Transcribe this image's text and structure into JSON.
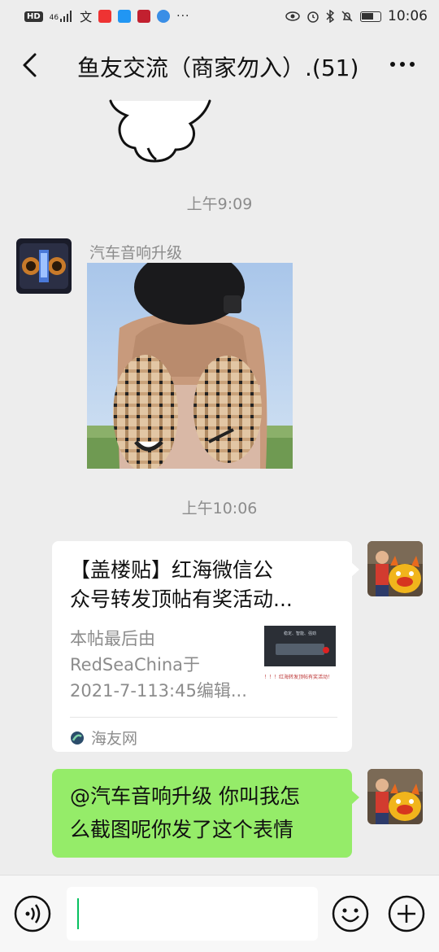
{
  "status_bar": {
    "left_icons": [
      "hd-icon",
      "signal-icon",
      "input-method-icon",
      "app-red-icon",
      "app-blue-icon",
      "app-target-icon",
      "app-globe-icon",
      "more-dots-icon"
    ],
    "hd_label": "HD",
    "network_label": "46",
    "right_icons": [
      "eye-icon",
      "alarm-icon",
      "bluetooth-icon",
      "mute-icon",
      "battery-icon"
    ],
    "time": "10:06"
  },
  "header": {
    "title": "鱼友交流（商家勿入）.(51)"
  },
  "chat": {
    "messages": [
      {
        "type": "timestamp",
        "text": "上午9:09"
      },
      {
        "type": "image",
        "sender": "汽车音响升级"
      },
      {
        "type": "timestamp",
        "text": "上午10:06"
      },
      {
        "type": "link_card",
        "title_line1": "【盖楼贴】红海微信公",
        "title_line2": "众号转发顶帖有奖活动...",
        "desc_line1": "本帖最后由",
        "desc_line2": "RedSeaChina于",
        "desc_line3": "2021-7-113:45编辑...",
        "thumb_text": "！！！红海转发顶帖有奖活动！",
        "thumb_caption": "稳定、智能、强劲",
        "source": "海友网"
      },
      {
        "type": "text",
        "line1": "@汽车音响升级  你叫我怎",
        "line2": "么截图呢你发了这个表情"
      }
    ]
  },
  "input_bar": {
    "text": ""
  },
  "colors": {
    "background": "#ededed",
    "bubble_self": "#95ec69",
    "cursor": "#07c160"
  }
}
